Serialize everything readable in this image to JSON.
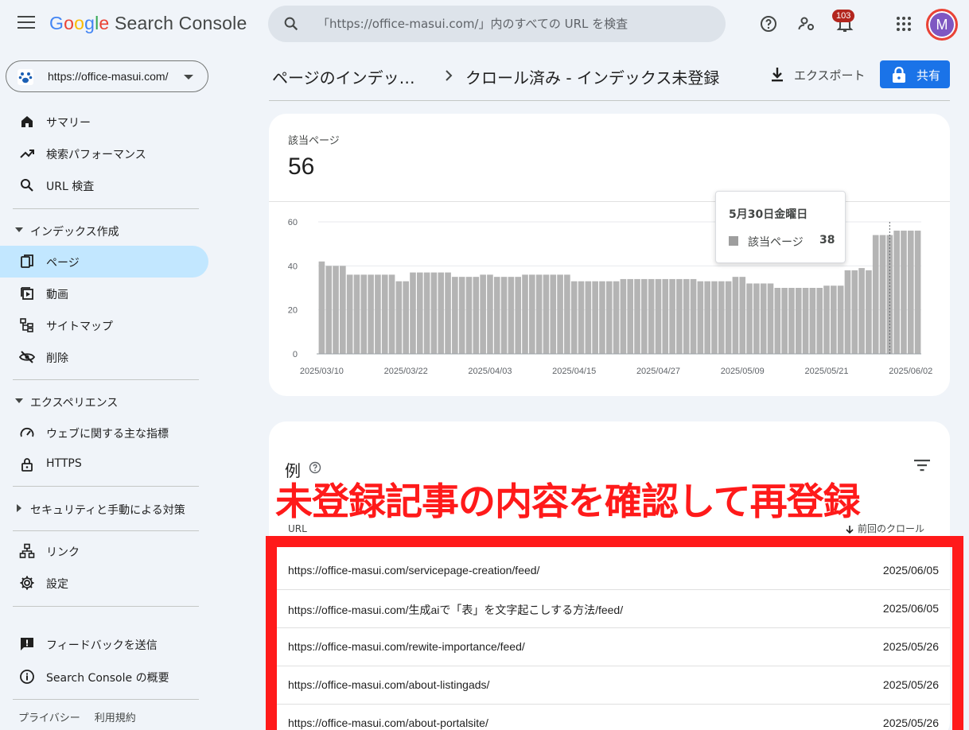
{
  "app": {
    "logo": {
      "g1": "G",
      "o1": "o",
      "o2": "o",
      "g2": "g",
      "l": "l",
      "e": "e",
      "rest": " Search Console"
    }
  },
  "search": {
    "placeholder": "「https://office-masui.com/」内のすべての URL を検査"
  },
  "notifications": {
    "count": "103"
  },
  "user": {
    "avatar_letter": "M"
  },
  "property": {
    "url": "https://office-masui.com/"
  },
  "sidebar": {
    "items": [
      {
        "label": "サマリー",
        "icon": "home-icon"
      },
      {
        "label": "検索パフォーマンス",
        "icon": "trending-up-icon"
      },
      {
        "label": "URL 検査",
        "icon": "search-icon"
      }
    ],
    "index_section": {
      "label": "インデックス作成"
    },
    "index_items": [
      {
        "label": "ページ",
        "icon": "pages-icon"
      },
      {
        "label": "動画",
        "icon": "video-icon"
      },
      {
        "label": "サイトマップ",
        "icon": "sitemap-icon"
      },
      {
        "label": "削除",
        "icon": "removal-icon"
      }
    ],
    "experience_section": {
      "label": "エクスペリエンス"
    },
    "experience_items": [
      {
        "label": "ウェブに関する主な指標",
        "icon": "speed-icon"
      },
      {
        "label": "HTTPS",
        "icon": "lock-icon"
      }
    ],
    "security_section": {
      "label": "セキュリティと手動による対策"
    },
    "other_items": [
      {
        "label": "リンク",
        "icon": "links-icon"
      },
      {
        "label": "設定",
        "icon": "gear-icon"
      }
    ],
    "bottom_items": [
      {
        "label": "フィードバックを送信",
        "icon": "feedback-icon"
      },
      {
        "label": "Search Console の概要",
        "icon": "info-icon"
      }
    ],
    "footer": {
      "privacy": "プライバシー",
      "terms": "利用規約"
    }
  },
  "header": {
    "crumb_parent": "ページのインデッ…",
    "crumb_current": "クロール済み - インデックス未登録",
    "export_label": "エクスポート",
    "share_label": "共有"
  },
  "summary": {
    "label": "該当ページ",
    "value": "56"
  },
  "tooltip": {
    "date": "5月30日金曜日",
    "series": "該当ページ",
    "value": "38"
  },
  "chart_data": {
    "type": "bar",
    "series": [
      {
        "name": "該当ページ",
        "color": "#b4b4b4"
      }
    ],
    "x_tick_labels": [
      "2025/03/10",
      "2025/03/22",
      "2025/04/03",
      "2025/04/15",
      "2025/04/27",
      "2025/05/09",
      "2025/05/21",
      "2025/06/02"
    ],
    "y_ticks": [
      0,
      20,
      40,
      60
    ],
    "ylim": [
      0,
      60
    ],
    "start_date": "2025/03/10",
    "values": [
      42,
      40,
      40,
      40,
      36,
      36,
      36,
      36,
      36,
      36,
      36,
      33,
      33,
      37,
      37,
      37,
      37,
      37,
      37,
      35,
      35,
      35,
      35,
      36,
      36,
      35,
      35,
      35,
      35,
      36,
      36,
      36,
      36,
      36,
      36,
      36,
      33,
      33,
      33,
      33,
      33,
      33,
      33,
      34,
      34,
      34,
      34,
      34,
      34,
      34,
      34,
      34,
      34,
      34,
      33,
      33,
      33,
      33,
      33,
      35,
      35,
      32,
      32,
      32,
      32,
      30,
      30,
      30,
      30,
      30,
      30,
      30,
      31,
      31,
      31,
      38,
      38,
      39,
      38,
      54,
      54,
      54,
      56,
      56,
      56,
      56
    ],
    "highlight_date": "2025/05/30",
    "highlight_value": 38,
    "grid": true
  },
  "examples": {
    "title": "例",
    "col_url": "URL",
    "col_crawl": "前回のクロール",
    "rows": [
      {
        "url": "https://office-masui.com/servicepage-creation/feed/",
        "date": "2025/06/05"
      },
      {
        "url": "https://office-masui.com/生成aiで「表」を文字起こしする方法/feed/",
        "date": "2025/06/05"
      },
      {
        "url": "https://office-masui.com/rewite-importance/feed/",
        "date": "2025/05/26"
      },
      {
        "url": "https://office-masui.com/about-listingads/",
        "date": "2025/05/26"
      },
      {
        "url": "https://office-masui.com/about-portalsite/",
        "date": "2025/05/26"
      }
    ]
  },
  "annotation": {
    "text": "未登録記事の内容を確認して再登録",
    "color": "#ff1a1a"
  }
}
